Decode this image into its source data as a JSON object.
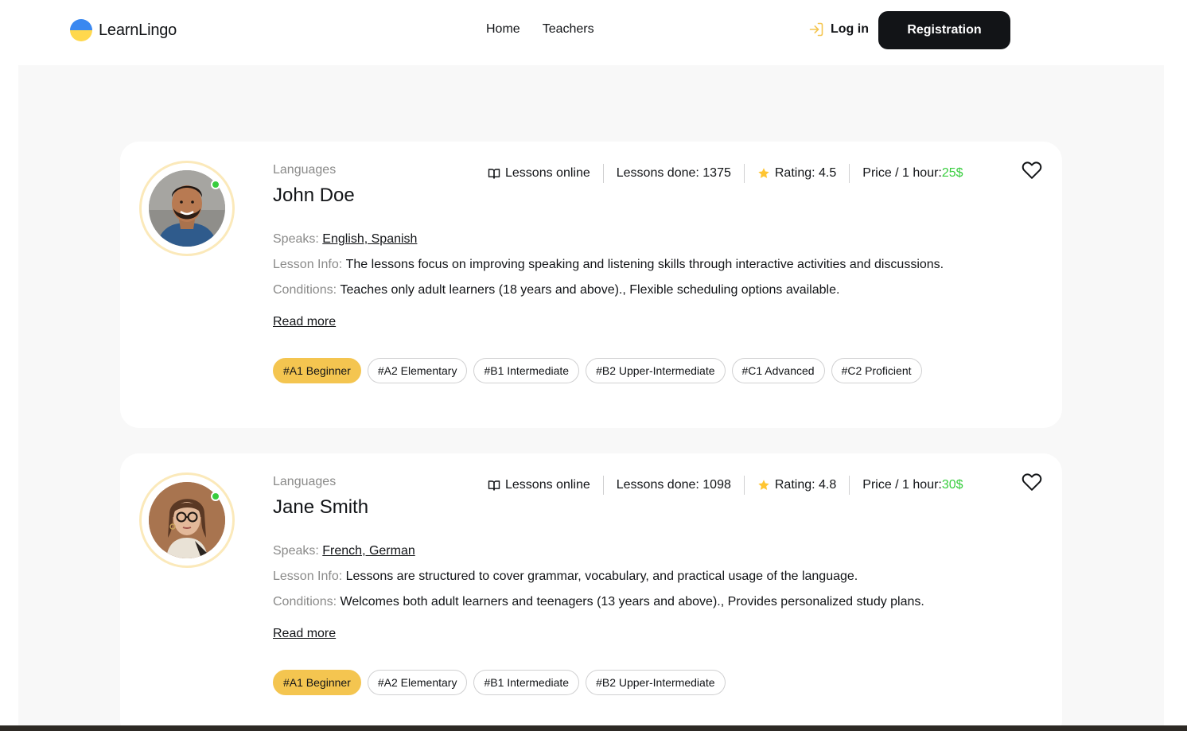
{
  "header": {
    "logo_text": "LearnLingo",
    "nav": [
      "Home",
      "Teachers"
    ],
    "login_label": "Log in",
    "registration_label": "Registration"
  },
  "colors": {
    "accent": "#f4c550",
    "price": "#38cd3e",
    "online": "#38cd3e",
    "dark": "#121417",
    "muted": "#8a8a89"
  },
  "teachers": [
    {
      "languages_label": "Languages",
      "name": "John Doe",
      "lessons_online": "Lessons online",
      "lessons_done": "Lessons done: 1375",
      "rating": "Rating: 4.5",
      "price_label": "Price / 1 hour: ",
      "price_value": "25$",
      "speaks_label": "Speaks: ",
      "speaks_value": "English, Spanish",
      "lesson_info_label": "Lesson Info: ",
      "lesson_info_value": "The lessons focus on improving speaking and listening skills through interactive activities and discussions.",
      "conditions_label": "Conditions: ",
      "conditions_value": "Teaches only adult learners (18 years and above)., Flexible scheduling options available.",
      "read_more": "Read more",
      "levels": [
        "#A1 Beginner",
        "#A2 Elementary",
        "#B1 Intermediate",
        "#B2 Upper-Intermediate",
        "#C1 Advanced",
        "#C2 Proficient"
      ]
    },
    {
      "languages_label": "Languages",
      "name": "Jane Smith",
      "lessons_online": "Lessons online",
      "lessons_done": "Lessons done: 1098",
      "rating": "Rating: 4.8",
      "price_label": "Price / 1 hour: ",
      "price_value": "30$",
      "speaks_label": "Speaks: ",
      "speaks_value": "French, German",
      "lesson_info_label": "Lesson Info: ",
      "lesson_info_value": "Lessons are structured to cover grammar, vocabulary, and practical usage of the language.",
      "conditions_label": "Conditions: ",
      "conditions_value": "Welcomes both adult learners and teenagers (13 years and above)., Provides personalized study plans.",
      "read_more": "Read more",
      "levels": [
        "#A1 Beginner",
        "#A2 Elementary",
        "#B1 Intermediate",
        "#B2 Upper-Intermediate"
      ]
    }
  ]
}
